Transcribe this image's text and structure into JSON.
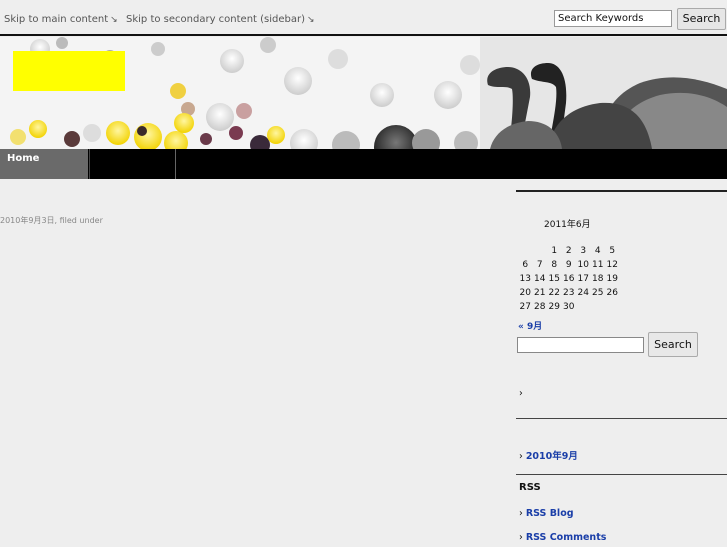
{
  "topbar": {
    "skip_main": "Skip to main content",
    "skip_sidebar": "Skip to secondary content (sidebar)",
    "arrow": "↘",
    "search_value": "Search Keywords",
    "search_button": "Search"
  },
  "site": {
    "title": "",
    "description": ""
  },
  "nav": {
    "items": [
      {
        "label": "Home"
      },
      {
        "label": ""
      }
    ]
  },
  "post": {
    "title": "",
    "meta": "2010年9月3日, filed under ",
    "line1": "",
    "line2": "",
    "link_text": "",
    "line3_rest": ""
  },
  "sidebar": {
    "calendar": {
      "caption": "2011年6月",
      "weekdays": [
        "",
        "",
        "",
        "",
        "",
        "",
        ""
      ],
      "weeks": [
        [
          "",
          "",
          "1",
          "2",
          "3",
          "4",
          "5"
        ],
        [
          "6",
          "7",
          "8",
          "9",
          "10",
          "11",
          "12"
        ],
        [
          "13",
          "14",
          "15",
          "16",
          "17",
          "18",
          "19"
        ],
        [
          "20",
          "21",
          "22",
          "23",
          "24",
          "25",
          "26"
        ],
        [
          "27",
          "28",
          "29",
          "30",
          "",
          "",
          ""
        ]
      ],
      "prev": "« 9月"
    },
    "search_button": "Search",
    "widgets": [
      {
        "title": "",
        "items": [
          ""
        ]
      },
      {
        "title": "",
        "items": [
          "2010年9月"
        ]
      },
      {
        "title": "RSS",
        "items": [
          "RSS Blog",
          "RSS Comments"
        ]
      }
    ],
    "chevron": "›"
  },
  "colors": {
    "logo_bg": "#ffff00",
    "link": "#1a3ea8",
    "nav_bg": "#000000",
    "nav_active": "#6a6a6a"
  }
}
